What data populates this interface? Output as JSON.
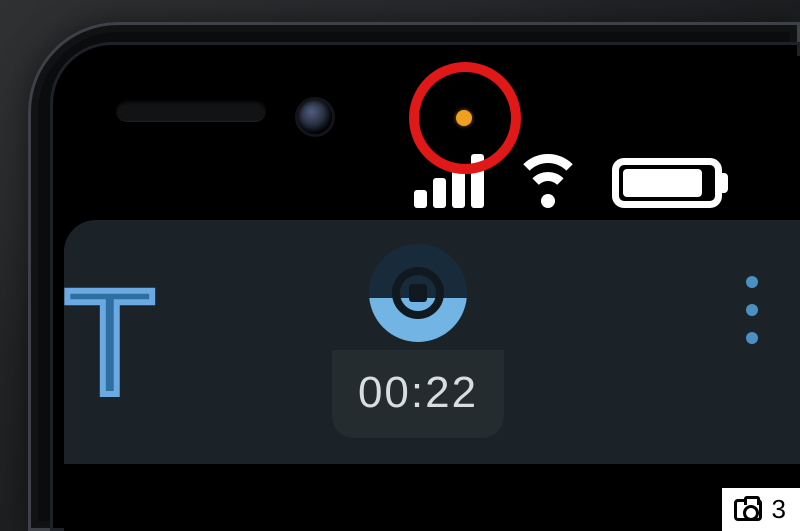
{
  "device": {
    "privacy_indicator": {
      "color": "#f0a020",
      "semantic": "microphone-in-use"
    },
    "statusbar": {
      "cellular_bars": 4,
      "wifi_strength": 3,
      "battery_percent": 82
    }
  },
  "app": {
    "partial_title_letter": "T",
    "recording": {
      "state": "recording",
      "elapsed": "00:22"
    },
    "menu_label": "more"
  },
  "overlay": {
    "annotation": "highlight-circle",
    "gallery_count": "3"
  },
  "colors": {
    "accent_blue": "#6aa9e2",
    "privacy_orange": "#f0a020",
    "annotation_red": "#e01818"
  }
}
